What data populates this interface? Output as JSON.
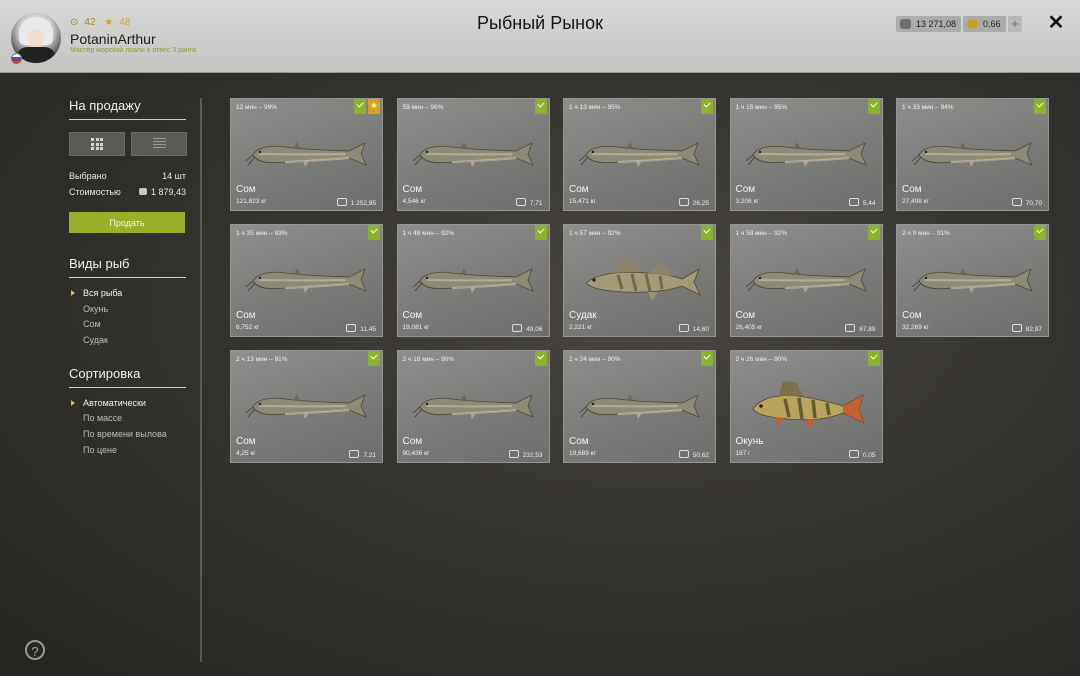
{
  "header": {
    "title": "Рыбный Рынок",
    "user": {
      "level": "42",
      "rank": "48",
      "name": "PotaninArthur",
      "title": "Мастер морской ловли в отвес 3 ранга"
    },
    "silver": "13 271,08",
    "gold": "0,66",
    "plus_label": "+",
    "close_label": "✕"
  },
  "sidebar": {
    "for_sale_title": "На продажу",
    "selected_label": "Выбрано",
    "selected_value": "14 шт",
    "cost_label": "Стоимостью",
    "cost_value": "1 879,43",
    "sell_label": "Продать",
    "fish_types_title": "Виды рыб",
    "fish_types": [
      "Вся рыба",
      "Окунь",
      "Сом",
      "Судак"
    ],
    "sort_title": "Сортировка",
    "sort_options": [
      "Автоматически",
      "По массе",
      "По времени вылова",
      "По цене"
    ],
    "help_label": "?"
  },
  "fish": [
    {
      "time": "12 мин – 99%",
      "name": "Сом",
      "weight": "121,823 кг",
      "price": "1 252,95",
      "kind": "catfish",
      "star": true
    },
    {
      "time": "59 мин – 96%",
      "name": "Сом",
      "weight": "4,546 кг",
      "price": "7,71",
      "kind": "catfish",
      "star": false
    },
    {
      "time": "1 ч 13 мин – 95%",
      "name": "Сом",
      "weight": "15,471 кг",
      "price": "26,25",
      "kind": "catfish",
      "star": false
    },
    {
      "time": "1 ч 15 мин – 95%",
      "name": "Сом",
      "weight": "3,206 кг",
      "price": "5,44",
      "kind": "catfish",
      "star": false
    },
    {
      "time": "1 ч 33 мин – 94%",
      "name": "Сом",
      "weight": "27,498 кг",
      "price": "70,70",
      "kind": "catfish",
      "star": false
    },
    {
      "time": "1 ч 35 мин – 93%",
      "name": "Сом",
      "weight": "6,752 кг",
      "price": "11,45",
      "kind": "catfish",
      "star": false
    },
    {
      "time": "1 ч 49 мин – 92%",
      "name": "Сом",
      "weight": "19,081 кг",
      "price": "49,06",
      "kind": "catfish",
      "star": false
    },
    {
      "time": "1 ч 57 мин – 92%",
      "name": "Судак",
      "weight": "2,221 кг",
      "price": "14,60",
      "kind": "zander",
      "star": false
    },
    {
      "time": "1 ч 58 мин – 92%",
      "name": "Сом",
      "weight": "26,405 кг",
      "price": "67,89",
      "kind": "catfish",
      "star": false
    },
    {
      "time": "2 ч 9 мин – 91%",
      "name": "Сом",
      "weight": "32,269 кг",
      "price": "82,97",
      "kind": "catfish",
      "star": false
    },
    {
      "time": "2 ч 13 мин – 91%",
      "name": "Сом",
      "weight": "4,25 кг",
      "price": "7,21",
      "kind": "catfish",
      "star": false
    },
    {
      "time": "2 ч 18 мин – 90%",
      "name": "Сом",
      "weight": "90,436 кг",
      "price": "232,53",
      "kind": "catfish",
      "star": false
    },
    {
      "time": "2 ч 24 мин – 90%",
      "name": "Сом",
      "weight": "19,689 кг",
      "price": "50,62",
      "kind": "catfish",
      "star": false
    },
    {
      "time": "2 ч 26 мин – 90%",
      "name": "Окунь",
      "weight": "167 г",
      "price": "0,05",
      "kind": "perch",
      "star": false
    }
  ]
}
